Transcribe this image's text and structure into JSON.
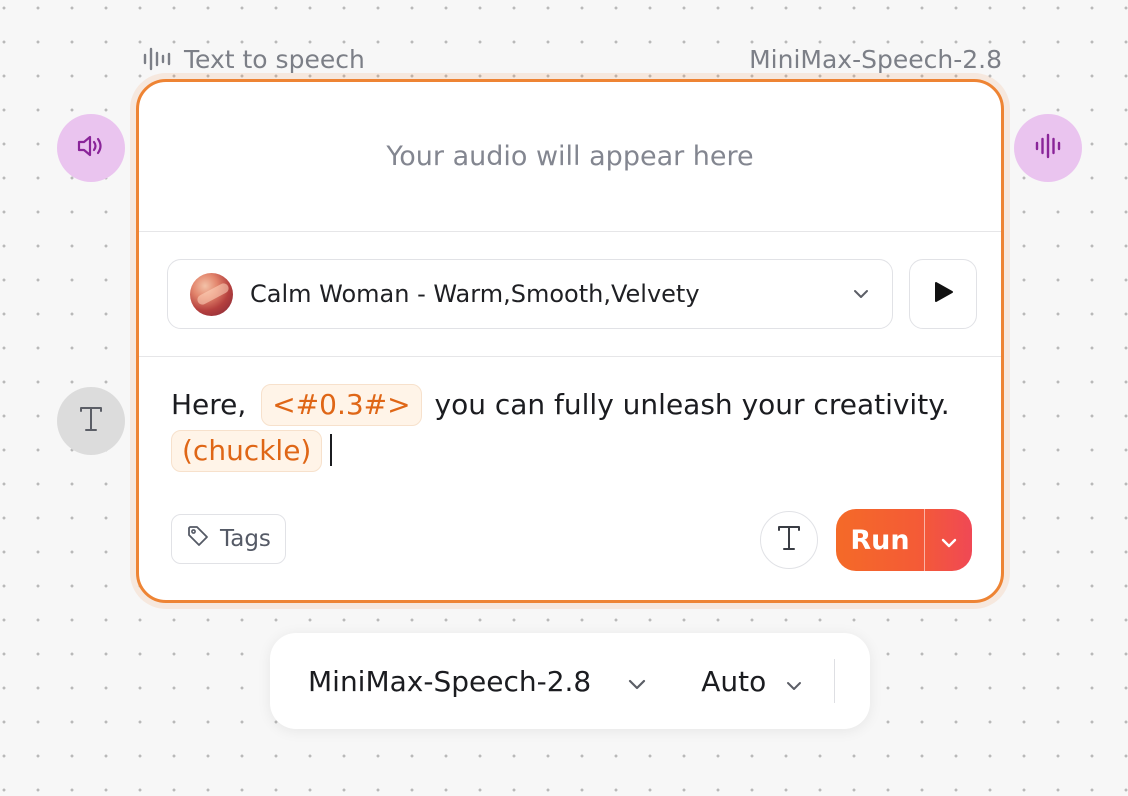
{
  "node": {
    "title": "Text to speech",
    "model_label": "MiniMax-Speech-2.8",
    "title_icon": "waveform-icon"
  },
  "handles": {
    "audio_in_icon": "speaker-icon",
    "audio_out_icon": "waveform-icon",
    "text_in_icon": "text-t-icon"
  },
  "audio": {
    "placeholder": "Your audio will appear here"
  },
  "voice": {
    "name": "Calm Woman - Warm,Smooth,Velvety",
    "play_icon": "play-icon"
  },
  "editor": {
    "text_before": "Here,",
    "pause_tag": "<#0.3#>",
    "text_after": "you can fully unleash your creativity.",
    "sound_tag": "(chuckle)"
  },
  "footer": {
    "tags_label": "Tags",
    "run_label": "Run"
  },
  "toolbar": {
    "model": "MiniMax-Speech-2.8",
    "mode": "Auto"
  },
  "colors": {
    "accent": "#ee8434",
    "tag_text": "#df6616",
    "handle_audio": "#eac4ef",
    "handle_text": "#dcdcdc",
    "run_gradient_start": "#f46a28",
    "run_gradient_end": "#f04855"
  }
}
